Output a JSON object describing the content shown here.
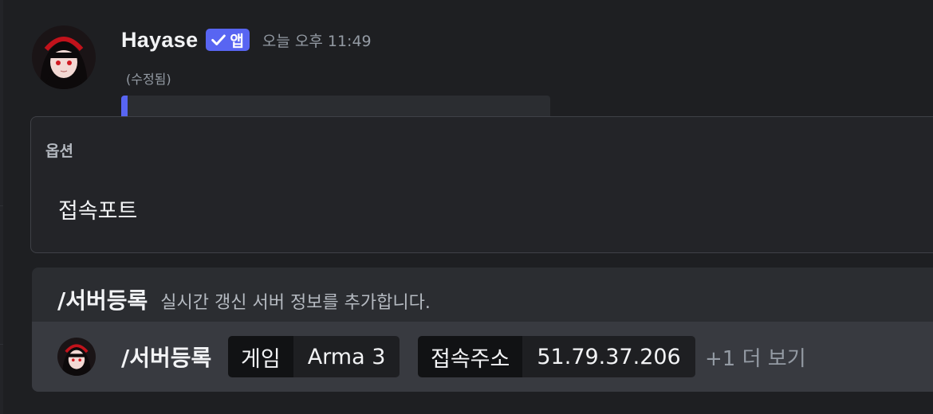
{
  "message": {
    "author": "Hayase",
    "badge_label": "앱",
    "timestamp": "오늘 오후 11:49",
    "edited_label": "(수정됨)",
    "accent_color": "#5865f2"
  },
  "autocomplete": {
    "header": "옵션",
    "options": [
      {
        "label": "접속포트"
      }
    ]
  },
  "command_info": {
    "name": "/서버등록",
    "description": "실시간 갱신 서버 정보를 추가합니다."
  },
  "command_input": {
    "command": "/서버등록",
    "options": [
      {
        "key": "게임",
        "value": "Arma 3"
      },
      {
        "key": "접속주소",
        "value": "51.79.37.206"
      }
    ],
    "more_label": "+1 더 보기"
  }
}
